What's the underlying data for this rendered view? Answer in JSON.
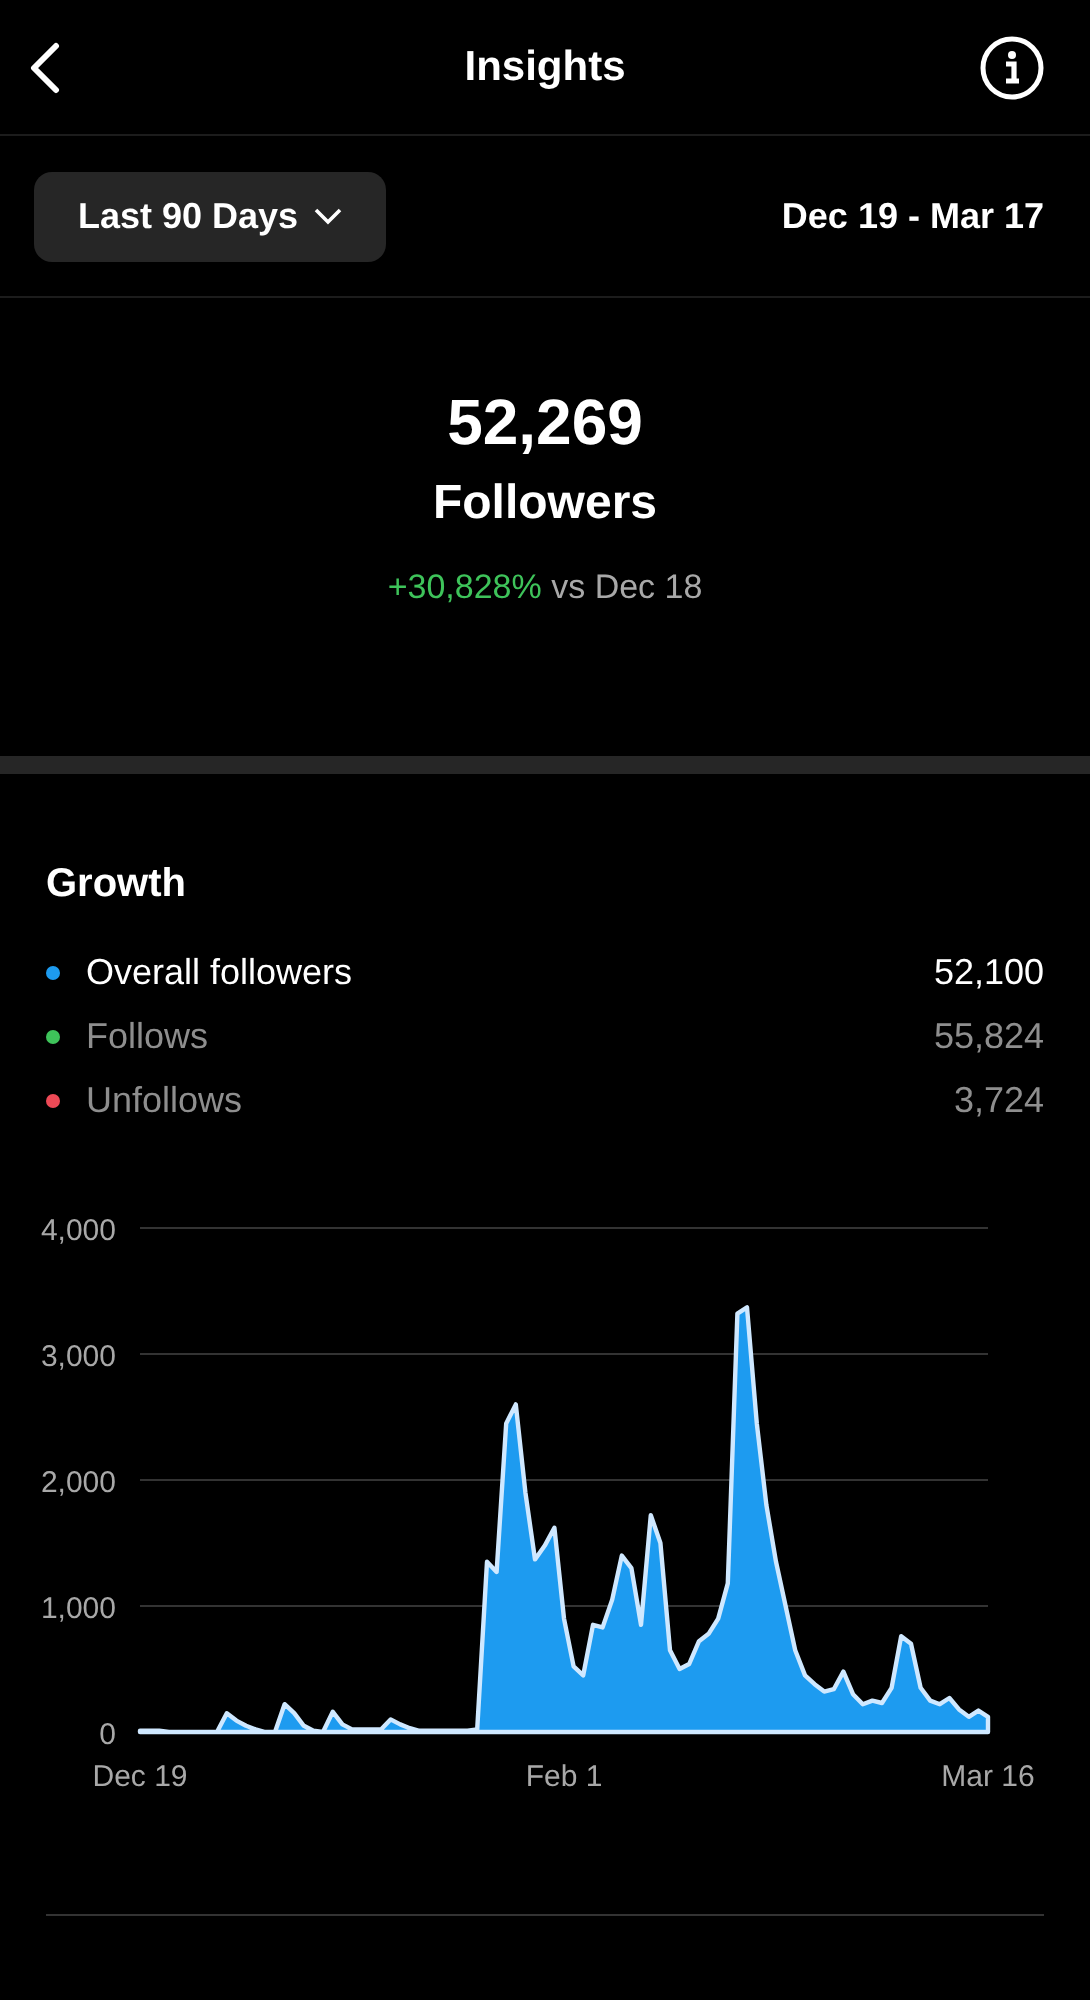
{
  "header": {
    "title": "Insights"
  },
  "filter": {
    "range_button": "Last 90 Days",
    "date_range": "Dec 19 - Mar 17"
  },
  "summary": {
    "count": "52,269",
    "label": "Followers",
    "change": "+30,828%",
    "comparison": "vs Dec 18"
  },
  "growth": {
    "title": "Growth",
    "legend": [
      {
        "label": "Overall followers",
        "value": "52,100",
        "color": "#1d9bf0",
        "selected": true
      },
      {
        "label": "Follows",
        "value": "55,824",
        "color": "#3ec35a",
        "selected": false
      },
      {
        "label": "Unfollows",
        "value": "3,724",
        "color": "#ed4956",
        "selected": false
      }
    ],
    "chart_data": {
      "type": "area",
      "grid": true,
      "categories": [
        "Dec 19",
        null,
        null,
        null,
        null,
        null,
        null,
        null,
        null,
        null,
        null,
        null,
        null,
        null,
        null,
        null,
        null,
        null,
        null,
        null,
        null,
        null,
        null,
        null,
        null,
        null,
        null,
        null,
        null,
        null,
        null,
        null,
        null,
        null,
        null,
        null,
        null,
        null,
        null,
        null,
        null,
        null,
        null,
        null,
        "Feb 1",
        null,
        null,
        null,
        null,
        null,
        null,
        null,
        null,
        null,
        null,
        null,
        null,
        null,
        null,
        null,
        null,
        null,
        null,
        null,
        null,
        null,
        null,
        null,
        null,
        null,
        null,
        null,
        null,
        null,
        null,
        null,
        null,
        null,
        null,
        null,
        null,
        null,
        null,
        null,
        null,
        null,
        null,
        null,
        "Mar 16"
      ],
      "ylim": [
        0,
        4000
      ],
      "yticks": [
        {
          "value": 0,
          "label": "0"
        },
        {
          "value": 1000,
          "label": "1,000"
        },
        {
          "value": 2000,
          "label": "2,000"
        },
        {
          "value": 3000,
          "label": "3,000"
        },
        {
          "value": 4000,
          "label": "4,000"
        }
      ],
      "series": [
        {
          "color": "#1d9bf0",
          "values": [
            10,
            10,
            10,
            0,
            0,
            0,
            0,
            0,
            0,
            150,
            90,
            50,
            20,
            0,
            0,
            220,
            150,
            50,
            10,
            0,
            160,
            60,
            20,
            20,
            20,
            20,
            100,
            60,
            30,
            10,
            10,
            10,
            10,
            10,
            10,
            20,
            1350,
            1270,
            2450,
            2600,
            1900,
            1370,
            1480,
            1620,
            900,
            520,
            450,
            850,
            830,
            1050,
            1400,
            1300,
            850,
            1720,
            1500,
            650,
            500,
            540,
            720,
            780,
            900,
            1180,
            3320,
            3370,
            2450,
            1800,
            1350,
            1000,
            650,
            450,
            380,
            320,
            340,
            480,
            300,
            220,
            250,
            230,
            350,
            760,
            700,
            350,
            250,
            220,
            270,
            180,
            120,
            170,
            120
          ]
        }
      ]
    }
  }
}
